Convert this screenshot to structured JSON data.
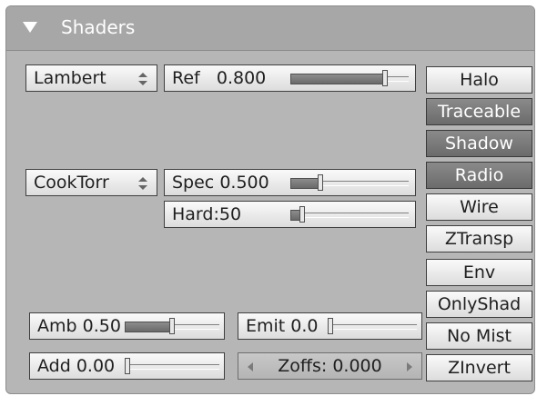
{
  "panel": {
    "title": "Shaders"
  },
  "diffuse": {
    "shader": "Lambert",
    "ref": {
      "label": "Ref",
      "value": "0.800",
      "level": 0.8
    }
  },
  "specular": {
    "shader": "CookTorr",
    "spec": {
      "label": "Spec",
      "value": "0.500",
      "level": 0.25
    },
    "hard": {
      "label": "Hard:",
      "value": "50",
      "level": 0.1
    }
  },
  "amb": {
    "label": "Amb",
    "value": "0.50",
    "level": 0.5
  },
  "emit": {
    "label": "Emit",
    "value": "0.0",
    "level": 0.0
  },
  "add": {
    "label": "Add",
    "value": "0.00",
    "level": 0.0
  },
  "zoffs": {
    "label": "Zoffs:",
    "value": "0.000"
  },
  "toggles": [
    {
      "label": "Halo",
      "on": false
    },
    {
      "label": "Traceable",
      "on": true
    },
    {
      "label": "Shadow",
      "on": true
    },
    {
      "label": "Radio",
      "on": true
    },
    {
      "label": "Wire",
      "on": false
    },
    {
      "label": "ZTransp",
      "on": false
    },
    {
      "label": "Env",
      "on": false
    },
    {
      "label": "OnlyShad",
      "on": false
    },
    {
      "label": "No Mist",
      "on": false
    },
    {
      "label": "ZInvert",
      "on": false
    }
  ],
  "colors": {
    "panel": "#b6b6b6",
    "header": "#a7a7a7",
    "toggle_on": "#7b7b7b"
  }
}
